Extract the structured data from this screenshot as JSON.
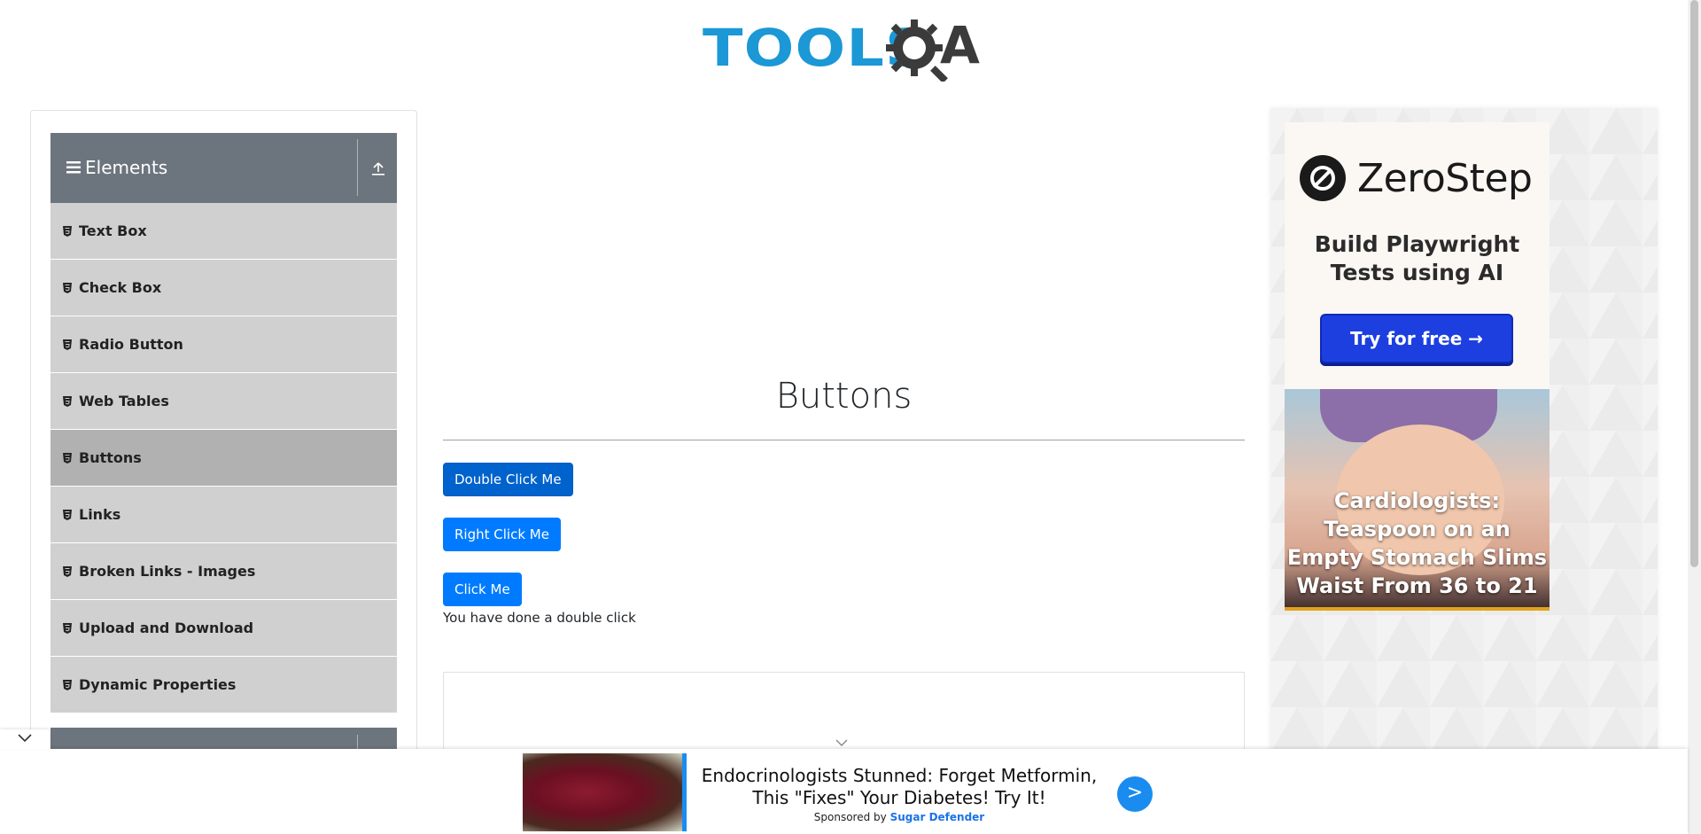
{
  "header": {
    "logo_main": "TOOLS",
    "logo_suffix": "A"
  },
  "sidebar": {
    "group_title": "Elements",
    "items": [
      {
        "label": "Text Box"
      },
      {
        "label": "Check Box"
      },
      {
        "label": "Radio Button"
      },
      {
        "label": "Web Tables"
      },
      {
        "label": "Buttons",
        "active": true
      },
      {
        "label": "Links"
      },
      {
        "label": "Broken Links - Images"
      },
      {
        "label": "Upload and Download"
      },
      {
        "label": "Dynamic Properties"
      }
    ]
  },
  "main": {
    "title": "Buttons",
    "double_click_label": "Double Click Me",
    "right_click_label": "Right Click Me",
    "click_label": "Click Me",
    "result_message": "You have done a double click"
  },
  "right_ad": {
    "brand": "ZeroStep",
    "tagline": "Build Playwright Tests using AI",
    "cta": "Try for free →",
    "promo_text": "Cardiologists: Teaspoon on an Empty Stomach Slims Waist From 36 to 21"
  },
  "bottom_ad": {
    "headline": "Endocrinologists Stunned: Forget Metformin, This \"Fixes\" Your Diabetes! Try It!",
    "sponsored_prefix": "Sponsored by",
    "sponsor": "Sugar Defender",
    "go_label": ">"
  },
  "colors": {
    "primary_button": "#007bff",
    "active_button": "#0062cc",
    "sidebar_header": "#6c757d",
    "sidebar_item": "#d0d0d0",
    "sidebar_item_active": "#b1b1b1",
    "logo_blue": "#1b98d5"
  }
}
